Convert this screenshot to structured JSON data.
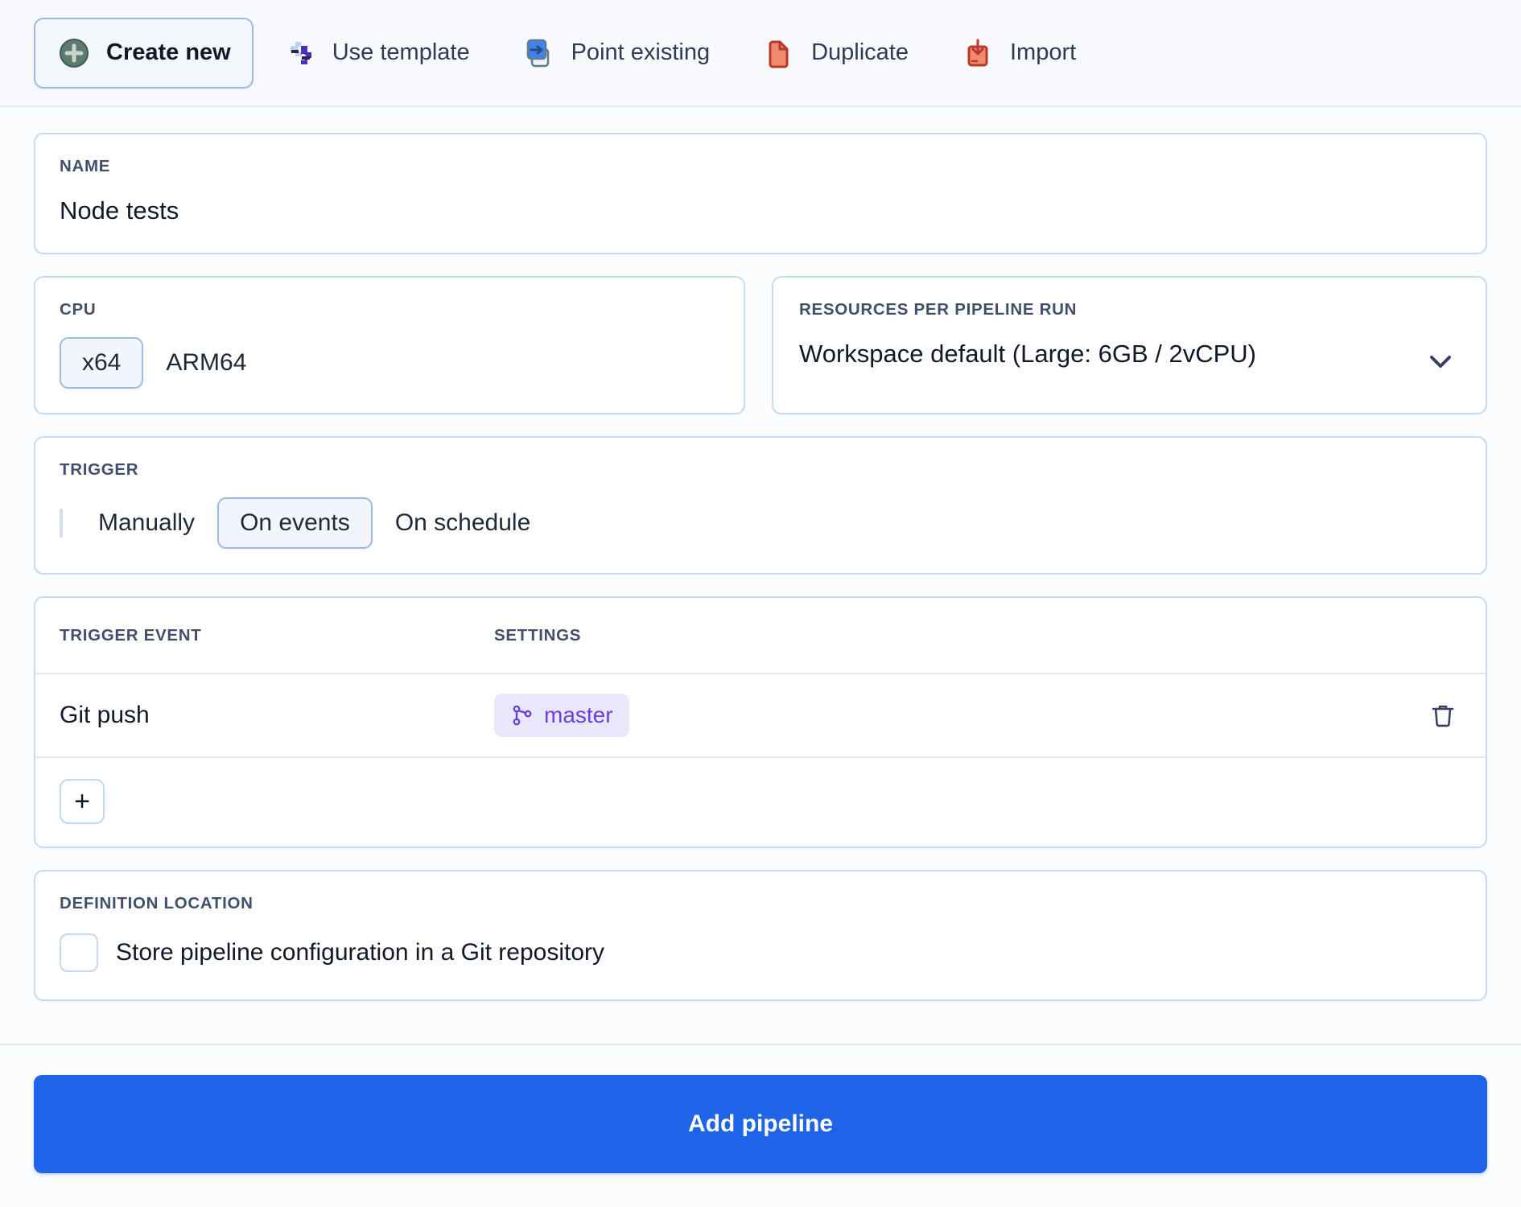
{
  "tabs": [
    {
      "label": "Create new",
      "icon": "plus-circle-icon",
      "active": true
    },
    {
      "label": "Use template",
      "icon": "puzzle-piece-icon",
      "active": false
    },
    {
      "label": "Point existing",
      "icon": "point-existing-icon",
      "active": false
    },
    {
      "label": "Duplicate",
      "icon": "duplicate-icon",
      "active": false
    },
    {
      "label": "Import",
      "icon": "import-icon",
      "active": false
    }
  ],
  "name_section": {
    "label": "NAME",
    "value": "Node tests"
  },
  "cpu_section": {
    "label": "CPU",
    "options": [
      "x64",
      "ARM64"
    ],
    "selected": "x64"
  },
  "resources_section": {
    "label": "RESOURCES PER PIPELINE RUN",
    "selected": "Workspace default (Large: 6GB / 2vCPU)",
    "chevron": "chevron-down-icon"
  },
  "trigger_section": {
    "label": "TRIGGER",
    "options": [
      "Manually",
      "On events",
      "On schedule"
    ],
    "selected": "On events"
  },
  "events_table": {
    "headers": [
      "TRIGGER EVENT",
      "SETTINGS"
    ],
    "rows": [
      {
        "event": "Git push",
        "setting": "master",
        "setting_icon": "git-branch-icon",
        "delete_icon": "trash-icon"
      }
    ],
    "add_label": "+"
  },
  "definition_section": {
    "label": "DEFINITION LOCATION",
    "checkbox_label": "Store pipeline configuration in a Git repository",
    "checked": false
  },
  "footer": {
    "submit_label": "Add pipeline"
  },
  "colors": {
    "primary": "#1f63e8",
    "panel_border": "#c9daef",
    "label_text": "#414f6b",
    "badge_bg": "#e9e7fb",
    "badge_text": "#6d3fdb",
    "icon_navy": "#374360"
  }
}
